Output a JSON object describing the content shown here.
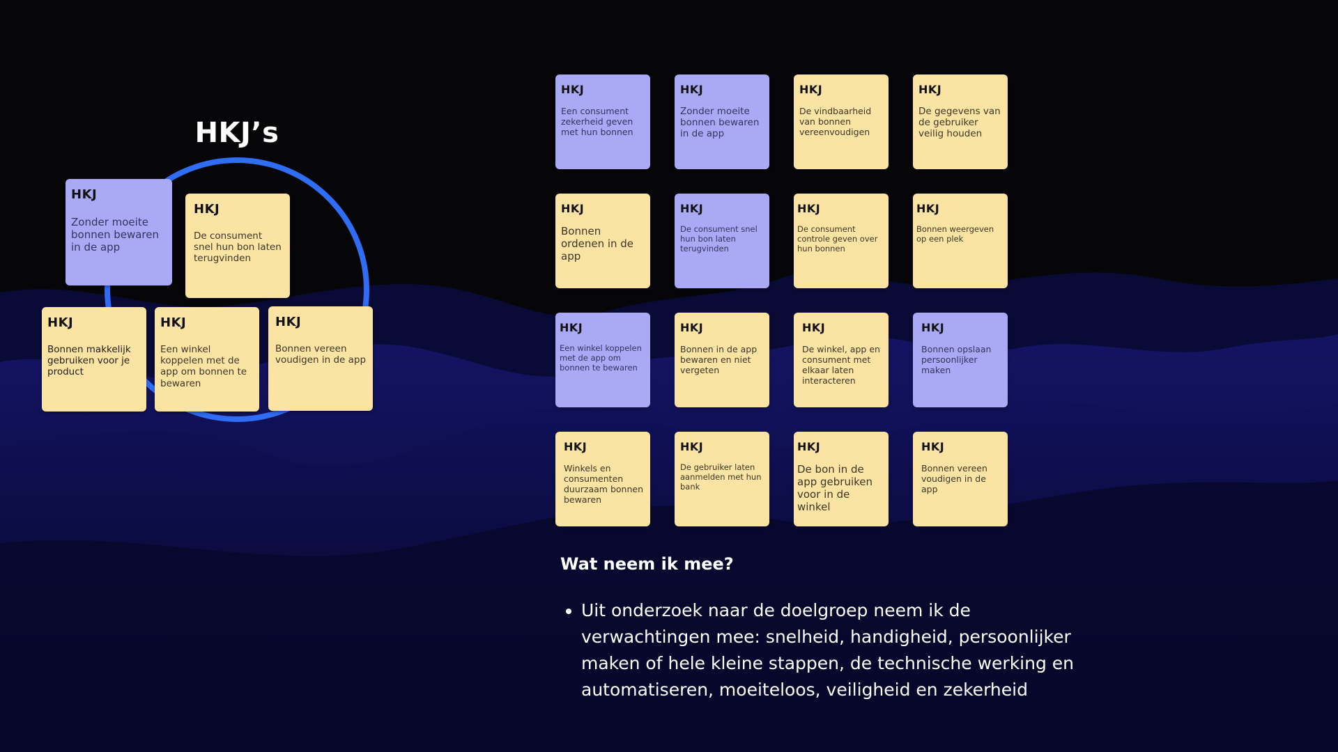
{
  "slide": {
    "title": "HKJ’s",
    "cluster_notes": [
      {
        "tag": "HKJ",
        "text": "Zonder moeite bonnen bewaren in de app",
        "color": "purple"
      },
      {
        "tag": "HKJ",
        "text": "De consument snel hun bon laten terugvinden",
        "color": "yellow"
      },
      {
        "tag": "HKJ",
        "text": "Bonnen makkelijk gebruiken voor je product",
        "color": "yellow"
      },
      {
        "tag": "HKJ",
        "text": "Een winkel koppelen met de app om bonnen te bewaren",
        "color": "yellow"
      },
      {
        "tag": "HKJ",
        "text": "Bonnen vereen voudigen in de app",
        "color": "yellow"
      }
    ],
    "grid_notes": [
      {
        "tag": "HKJ",
        "text": "Een consument zekerheid geven met hun bonnen",
        "color": "purple"
      },
      {
        "tag": "HKJ",
        "text": "Zonder moeite bonnen bewaren in de app",
        "color": "purple"
      },
      {
        "tag": "HKJ",
        "text": "De vindbaarheid van bonnen vereenvoudigen",
        "color": "yellow"
      },
      {
        "tag": "HKJ",
        "text": "De gegevens van de gebruiker veilig houden",
        "color": "yellow"
      },
      {
        "tag": "HKJ",
        "text": "Bonnen ordenen in de app",
        "color": "yellow"
      },
      {
        "tag": "HKJ",
        "text": "De consument snel hun bon laten terugvinden",
        "color": "purple"
      },
      {
        "tag": "HKJ",
        "text": "De consument controle geven over hun bonnen",
        "color": "yellow"
      },
      {
        "tag": "HKJ",
        "text": "Bonnen weergeven op een plek",
        "color": "yellow"
      },
      {
        "tag": "HKJ",
        "text": "Een winkel koppelen met de app om bonnen te bewaren",
        "color": "purple"
      },
      {
        "tag": "HKJ",
        "text": "Bonnen in de app bewaren en niet vergeten",
        "color": "yellow"
      },
      {
        "tag": "HKJ",
        "text": "De winkel, app en consument met elkaar laten interacteren",
        "color": "yellow"
      },
      {
        "tag": "HKJ",
        "text": "Bonnen opslaan persoonlijker maken",
        "color": "purple"
      },
      {
        "tag": "HKJ",
        "text": "Winkels en consumenten duurzaam bonnen bewaren",
        "color": "yellow"
      },
      {
        "tag": "HKJ",
        "text": "De gebruiker laten aanmelden met hun bank",
        "color": "yellow"
      },
      {
        "tag": "HKJ",
        "text": "De bon in de app gebruiken voor in de winkel",
        "color": "yellow"
      },
      {
        "tag": "HKJ",
        "text": "Bonnen vereen voudigen in de app",
        "color": "yellow"
      }
    ],
    "takeaway_heading": "Wat neem ik mee?",
    "takeaway_bullets": [
      "Uit onderzoek naar de doelgroep neem ik de verwachtingen mee: snelheid, handigheid, persoonlijker maken of hele kleine stappen, de technische werking en automatiseren, moeiteloos, veiligheid en zekerheid"
    ]
  },
  "colors": {
    "note_yellow": "#fbe3a4",
    "note_purple": "#a9a9f5",
    "ring_blue": "#2f6df4",
    "background_dark": "#060609",
    "wave_navy": "#0c0c4a"
  }
}
